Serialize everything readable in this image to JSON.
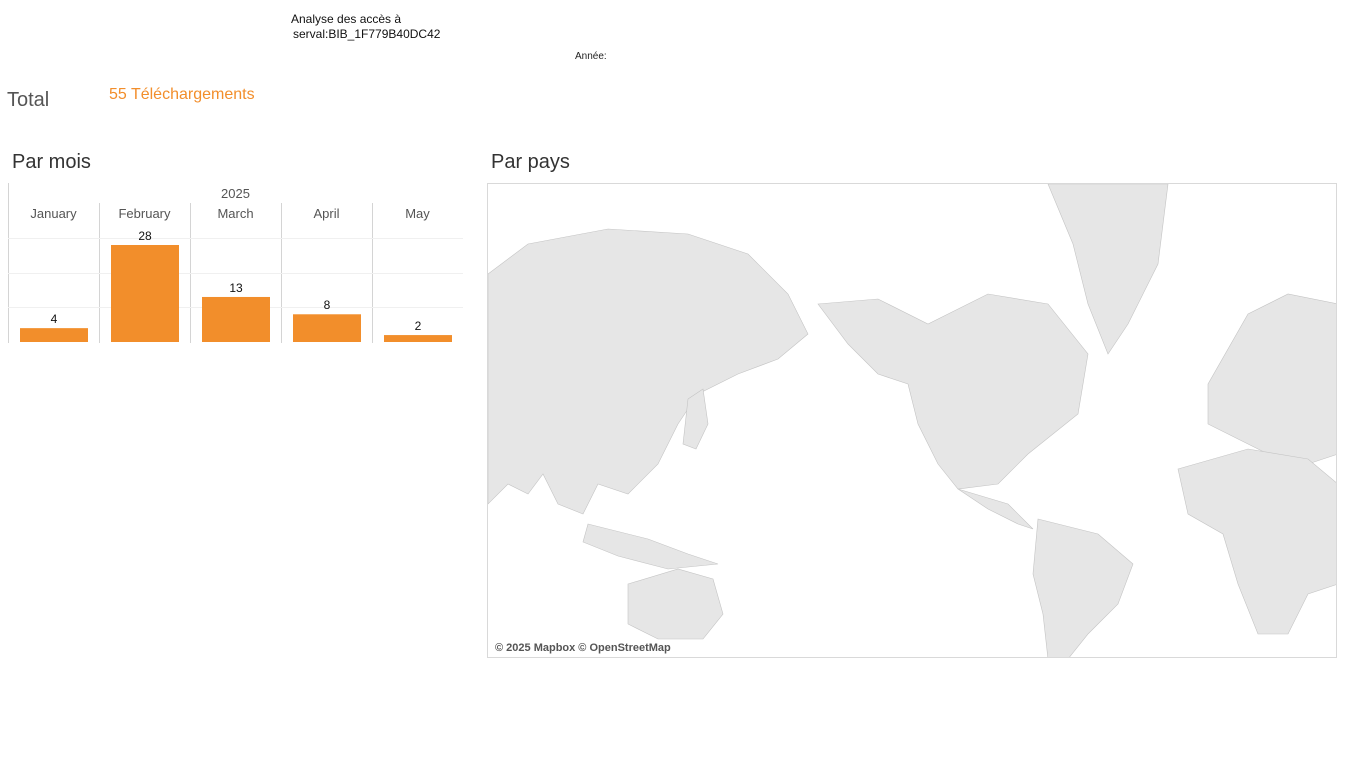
{
  "header": {
    "title_line1": "Analyse des accès à",
    "title_line2": "serval:BIB_1F779B40DC42",
    "year_filter_label": "Année:"
  },
  "summary": {
    "total_label": "Total",
    "total_value": "55 Téléchargements"
  },
  "sections": {
    "by_month": "Par mois",
    "by_country": "Par pays"
  },
  "chart_data": {
    "type": "bar",
    "group_label": "2025",
    "categories": [
      "January",
      "February",
      "March",
      "April",
      "May"
    ],
    "values": [
      4,
      28,
      13,
      8,
      2
    ],
    "ylim": [
      0,
      28
    ],
    "grid": true
  },
  "map": {
    "credit": "© 2025 Mapbox © OpenStreetMap"
  },
  "colors": {
    "accent": "#f28e2b",
    "land": "#e8e8e8",
    "border": "#bbbbbb"
  }
}
